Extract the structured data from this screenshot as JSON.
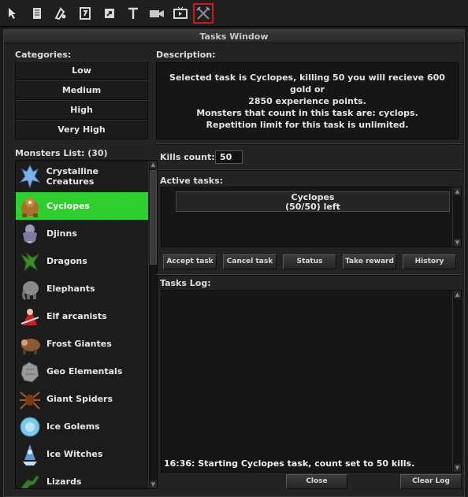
{
  "toolbar": {
    "buttons": [
      {
        "name": "cursor-icon"
      },
      {
        "name": "notes-icon"
      },
      {
        "name": "skills-icon"
      },
      {
        "name": "spellbook-icon"
      },
      {
        "name": "minimap-icon"
      },
      {
        "name": "text-icon"
      },
      {
        "name": "camera-icon"
      },
      {
        "name": "tv-icon"
      },
      {
        "name": "tasks-icon"
      }
    ],
    "active": "tasks-icon"
  },
  "window": {
    "title": "Tasks Window"
  },
  "categories": {
    "label": "Categories:",
    "items": [
      "Low",
      "Medium",
      "High",
      "Very High"
    ]
  },
  "monsters": {
    "label": "Monsters List: (30)",
    "selected": "Cyclopes",
    "items": [
      "Crystalline Creatures",
      "Cyclopes",
      "Djinns",
      "Dragons",
      "Elephants",
      "Elf arcanists",
      "Frost Giantes",
      "Geo Elementals",
      "Giant Spiders",
      "Ice Golems",
      "Ice Witches",
      "Lizards"
    ]
  },
  "description": {
    "label": "Description:",
    "lines": [
      "Selected task is Cyclopes, killing 50 you will recieve 600 gold or",
      "2850 experience points.",
      "Monsters that count in this task are: cyclops.",
      "Repetition limit for this task is unlimited."
    ]
  },
  "kills": {
    "label": "Kills count:",
    "value": "50"
  },
  "active_tasks": {
    "label": "Active tasks:",
    "entry_name": "Cyclopes",
    "entry_progress": "(50/50) left"
  },
  "buttons": {
    "accept": "Accept task",
    "cancel": "Cancel task",
    "status": "Status",
    "reward": "Take reward",
    "history": "History",
    "close": "Close",
    "clear_log": "Clear Log"
  },
  "log": {
    "label": "Tasks Log:",
    "lines": [
      "16:36: Starting Cyclopes task, count set to 50 kills."
    ]
  },
  "colors": {
    "selected_row": "#2fcf2f",
    "active_toolbar_border": "#d01818"
  }
}
